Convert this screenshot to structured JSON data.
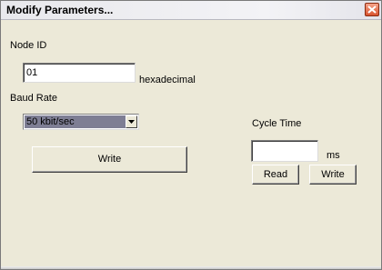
{
  "window": {
    "title": "Modify Parameters..."
  },
  "node_id": {
    "label": "Node ID",
    "value": "01",
    "unit": "hexadecimal"
  },
  "baud_rate": {
    "label": "Baud Rate",
    "selected": "50 kbit/sec"
  },
  "write_main": {
    "label": "Write"
  },
  "cycle_time": {
    "label": "Cycle Time",
    "value": "",
    "unit": "ms",
    "read_label": "Read",
    "write_label": "Write"
  },
  "colors": {
    "combo_highlight": "#7e7e94",
    "close_button": "#d8542e"
  },
  "icons": {
    "close": "close-icon",
    "dropdown": "chevron-down-icon"
  }
}
